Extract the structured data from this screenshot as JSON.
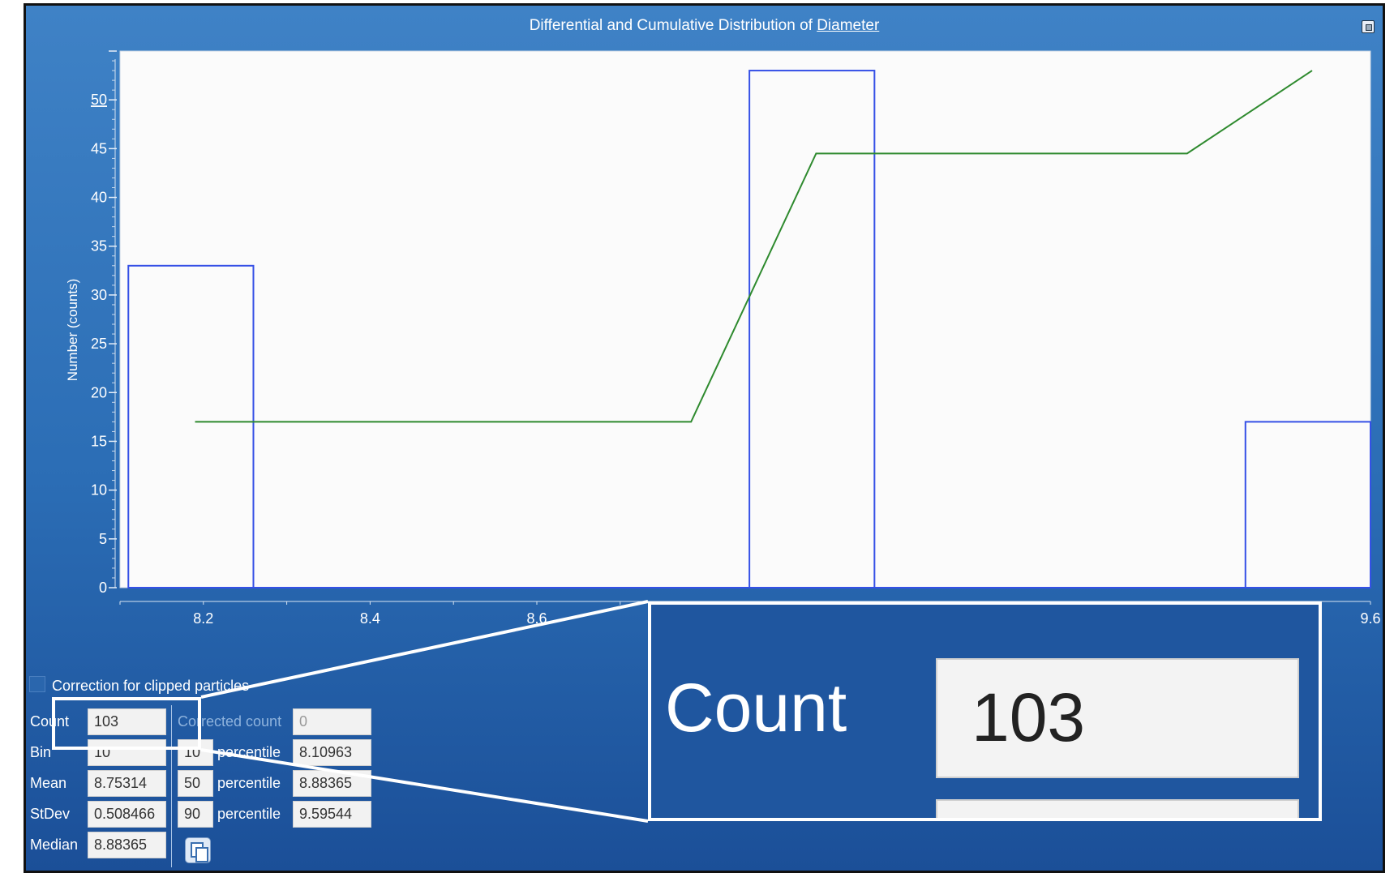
{
  "window": {
    "title_prefix": "Differential and Cumulative Distribution of",
    "title_variable": "Diameter"
  },
  "chart_data": {
    "type": "bar",
    "ylabel": "Number (counts)",
    "xlabel": "",
    "ylim": [
      0,
      55
    ],
    "xlim": [
      8.1,
      9.6
    ],
    "y_ticks": [
      "0",
      "5",
      "10",
      "15",
      "20",
      "25",
      "30",
      "35",
      "40",
      "45",
      "50"
    ],
    "x_ticks": [
      "8.2",
      "8.4",
      "8.6",
      "9.6"
    ],
    "series": [
      {
        "kind": "histogram",
        "bars": [
          {
            "x0": 8.11,
            "x1": 8.26,
            "value": 33
          },
          {
            "x0": 8.855,
            "x1": 9.005,
            "value": 53
          },
          {
            "x0": 9.45,
            "x1": 9.6,
            "value": 17
          }
        ]
      },
      {
        "kind": "cumulative-line",
        "x": [
          8.19,
          8.785,
          8.935,
          9.38,
          9.53
        ],
        "y": [
          17,
          17,
          44.5,
          44.5,
          53
        ]
      }
    ],
    "colors": {
      "bars": "#3550e6",
      "line": "#2e8a2e",
      "plot_bg": "#fbfbfb"
    }
  },
  "controls": {
    "correction_label": "Correction for clipped particles",
    "correction_checked": false,
    "count_label": "Count",
    "count_value": "103",
    "bin_label": "Bin",
    "bin_value": "10",
    "mean_label": "Mean",
    "mean_value": "8.75314",
    "stdev_label": "StDev",
    "stdev_value": "0.508466",
    "median_label": "Median",
    "median_value": "8.88365",
    "corrected_count_label": "Corrected count",
    "corrected_count_value": "0",
    "percentile_label": "percentile",
    "percentiles": [
      {
        "p": "10",
        "value": "8.10963"
      },
      {
        "p": "50",
        "value": "8.88365"
      },
      {
        "p": "90",
        "value": "9.59544"
      }
    ]
  },
  "zoom": {
    "label": "Count",
    "value": "103"
  },
  "icons": {
    "restore": "window-restore-icon",
    "copy": "copy-icon",
    "checkbox": "checkbox-icon"
  }
}
